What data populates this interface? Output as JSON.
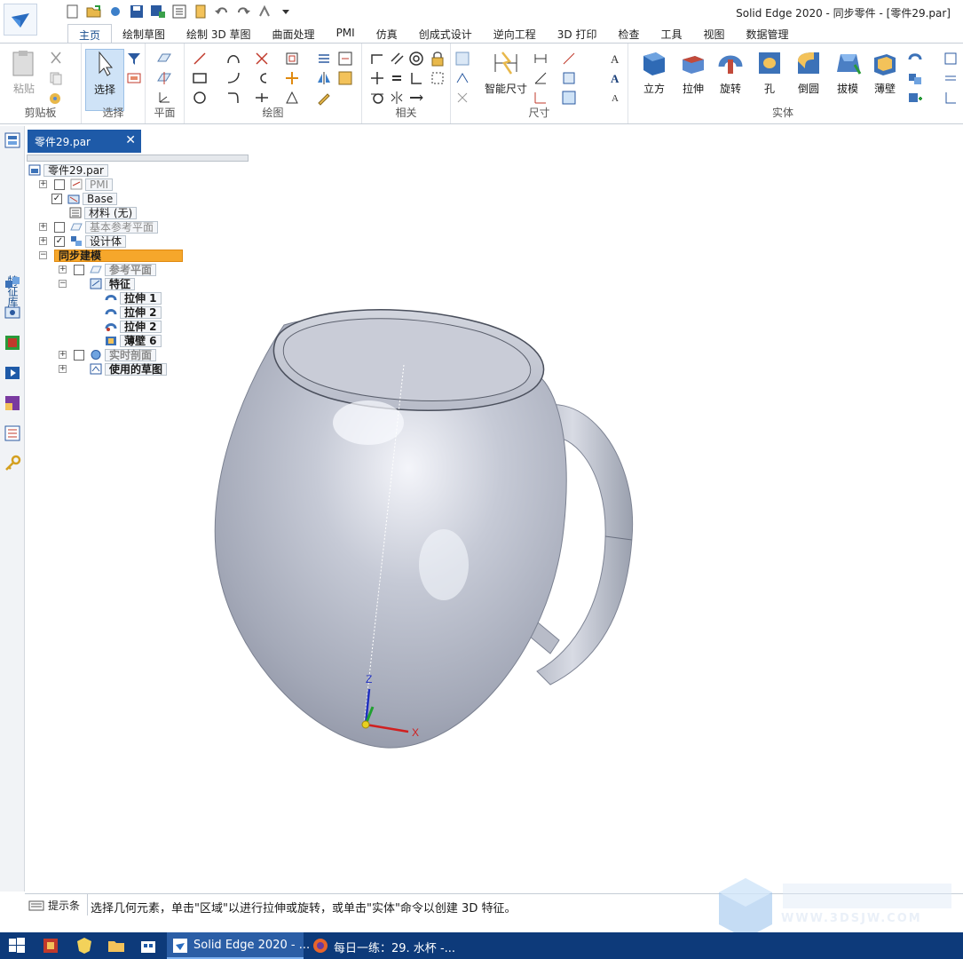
{
  "window": {
    "title": "Solid Edge 2020 - 同步零件 - [零件29.par]"
  },
  "ribbon": {
    "tabs": [
      {
        "label": "主页",
        "active": true
      },
      {
        "label": "绘制草图"
      },
      {
        "label": "绘制 3D 草图"
      },
      {
        "label": "曲面处理"
      },
      {
        "label": "PMI"
      },
      {
        "label": "仿真"
      },
      {
        "label": "创成式设计"
      },
      {
        "label": "逆向工程"
      },
      {
        "label": "3D 打印"
      },
      {
        "label": "检查"
      },
      {
        "label": "工具"
      },
      {
        "label": "视图"
      },
      {
        "label": "数据管理"
      }
    ],
    "groups": {
      "clipboard": {
        "label": "剪贴板",
        "paste_label": "粘贴"
      },
      "select": {
        "label": "选择",
        "select_label": "选择"
      },
      "plane": {
        "label": "平面"
      },
      "draw": {
        "label": "绘图"
      },
      "relate": {
        "label": "相关"
      },
      "dimension": {
        "label": "尺寸",
        "smart_dim_label": "智能尺寸"
      },
      "solid": {
        "label": "实体",
        "buttons": [
          "立方",
          "拉伸",
          "旋转",
          "孔",
          "倒圆",
          "拔模",
          "薄壁"
        ]
      }
    }
  },
  "document": {
    "tab_label": "零件29.par"
  },
  "leftbar": {
    "tab_label": "特征库"
  },
  "pathfinder": {
    "root": "零件29.par",
    "nodes": {
      "pmi": "PMI",
      "base": "Base",
      "material": "材料 (无)",
      "base_ref_planes": "基本参考平面",
      "design_body": "设计体",
      "sync_modeling": "同步建模",
      "ref_planes": "参考平面",
      "features": "特征",
      "extrude1": "拉伸 1",
      "extrude2a": "拉伸 2",
      "extrude2b": "拉伸 2",
      "shell6": "薄壁 6",
      "live_section": "实时剖面",
      "used_sketches": "使用的草图"
    }
  },
  "viewport": {
    "axis_x": "X",
    "axis_z": "Z"
  },
  "status": {
    "prompt_label": "提示条",
    "prompt_text": "选择几何元素，单击\"区域\"以进行拉伸或旋转，或单击\"实体\"命令以创建 3D 特征。"
  },
  "taskbar": {
    "apps": [
      {
        "label": "Solid Edge 2020 - ...",
        "active": true
      },
      {
        "label": "每日一练：29. 水杯 -..."
      }
    ]
  },
  "watermark": {
    "url": "WWW.3DSJW.COM"
  }
}
